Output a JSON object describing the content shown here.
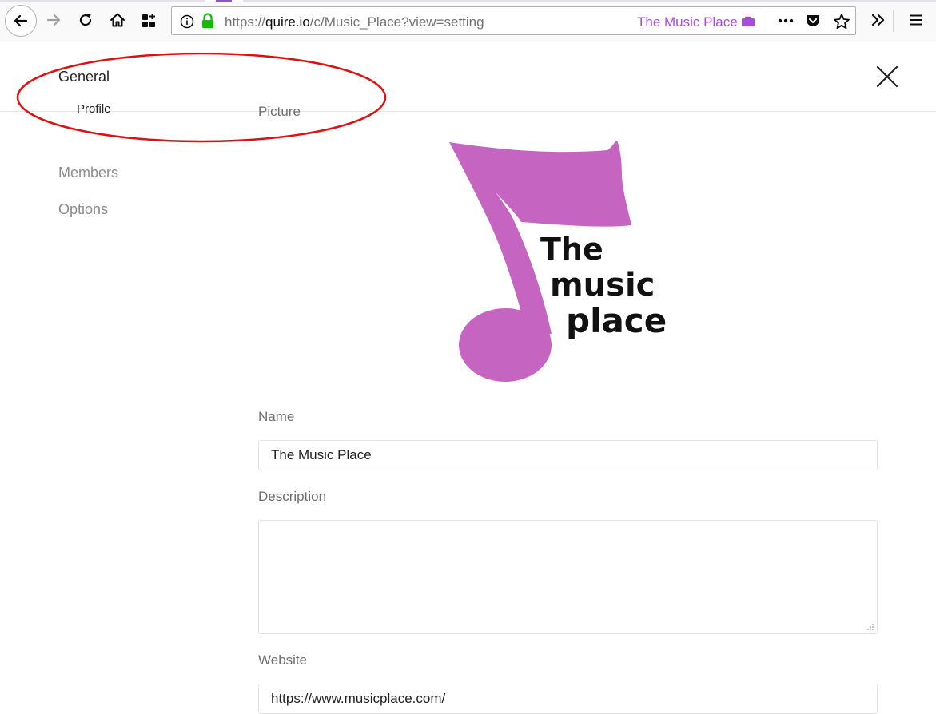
{
  "browser": {
    "url_prefix": "https://",
    "url_host": "quire.io",
    "url_path": "/c/Music_Place?view=setting",
    "site_label": "The Music Place",
    "colors": {
      "site_label": "#a84bd8",
      "lock": "#12bc00"
    }
  },
  "sidebar": {
    "general": "General",
    "profile": "Profile",
    "members": "Members",
    "options": "Options"
  },
  "picture_section": {
    "label": "Picture",
    "logo_line1": "The",
    "logo_line2": "music",
    "logo_line3": "place",
    "logo_color": "#c665c1"
  },
  "form": {
    "name_label": "Name",
    "name_value": "The Music Place",
    "description_label": "Description",
    "description_value": "",
    "website_label": "Website",
    "website_value": "https://www.musicplace.com/"
  },
  "annotation_color": "#e01010"
}
